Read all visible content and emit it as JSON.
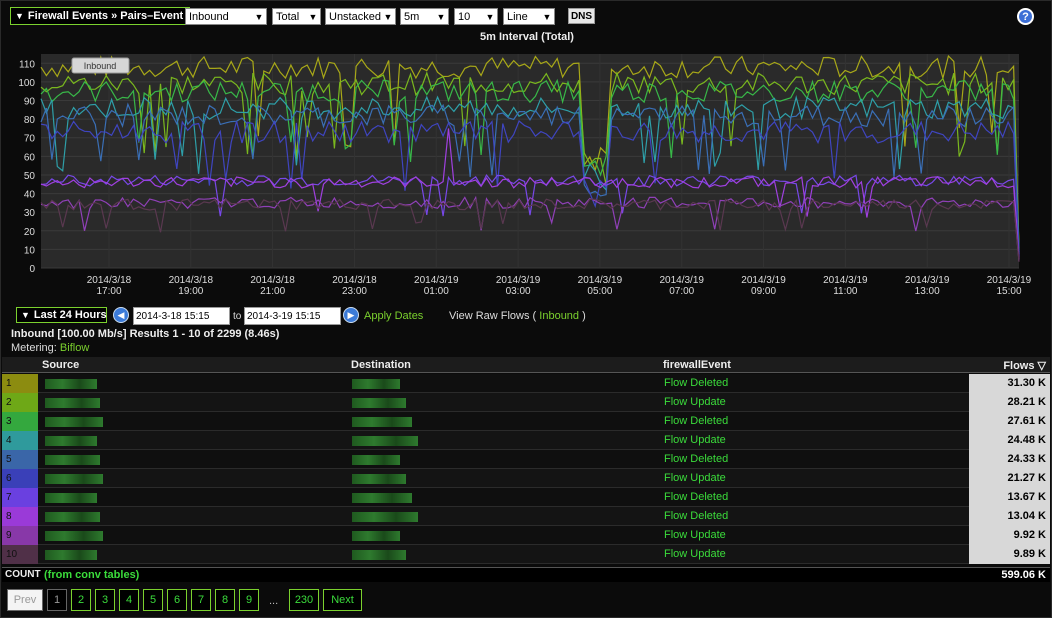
{
  "header": {
    "breadcrumb": "Firewall Events » Pairs–Event",
    "selects": [
      {
        "name": "direction-select",
        "value": "Inbound"
      },
      {
        "name": "total-select",
        "value": "Total"
      },
      {
        "name": "stacking-select",
        "value": "Unstacked"
      },
      {
        "name": "interval-select",
        "value": "5m"
      },
      {
        "name": "count-select",
        "value": "10"
      },
      {
        "name": "charttype-select",
        "value": "Line"
      }
    ],
    "dns_label": "DNS",
    "help_label": "?"
  },
  "chart_data": {
    "type": "line",
    "title": "5m Interval (Total)",
    "tooltip_label": "Inbound",
    "ylim": [
      0,
      115
    ],
    "yticks": [
      0,
      10,
      20,
      30,
      40,
      50,
      60,
      70,
      80,
      90,
      100,
      110
    ],
    "xticks": [
      {
        "date": "2014/3/18",
        "time": "17:00"
      },
      {
        "date": "2014/3/18",
        "time": "19:00"
      },
      {
        "date": "2014/3/18",
        "time": "21:00"
      },
      {
        "date": "2014/3/18",
        "time": "23:00"
      },
      {
        "date": "2014/3/19",
        "time": "01:00"
      },
      {
        "date": "2014/3/19",
        "time": "03:00"
      },
      {
        "date": "2014/3/19",
        "time": "05:00"
      },
      {
        "date": "2014/3/19",
        "time": "07:00"
      },
      {
        "date": "2014/3/19",
        "time": "09:00"
      },
      {
        "date": "2014/3/19",
        "time": "11:00"
      },
      {
        "date": "2014/3/19",
        "time": "13:00"
      },
      {
        "date": "2014/3/19",
        "time": "15:00"
      }
    ],
    "grid": true,
    "series": [
      {
        "rank": "1",
        "color": "#a8a818",
        "level": 108
      },
      {
        "rank": "2",
        "color": "#7ab81e",
        "level": 99
      },
      {
        "rank": "3",
        "color": "#38b848",
        "level": 95
      },
      {
        "rank": "4",
        "color": "#2e9fa8",
        "level": 86
      },
      {
        "rank": "5",
        "color": "#3a6fb6",
        "level": 82
      },
      {
        "rank": "6",
        "color": "#3f45c0",
        "level": 73
      },
      {
        "rank": "7",
        "color": "#7848e8",
        "level": 47
      },
      {
        "rank": "8",
        "color": "#a040e0",
        "level": 46
      },
      {
        "rank": "9",
        "color": "#9040b8",
        "level": 35
      },
      {
        "rank": "10",
        "color": "#5a3850",
        "level": 34
      }
    ]
  },
  "daterange": {
    "range_label": "Last 24 Hours",
    "start": "2014-3-18 15:15",
    "to_label": "to",
    "end": "2014-3-19 15:15",
    "apply_label": "Apply Dates",
    "raw_prefix": "View Raw Flows (",
    "raw_link": "Inbound",
    "raw_suffix": ")"
  },
  "summary": {
    "text": "Inbound [100.00 Mb/s] Results 1 - 10 of 2299 (8.46s)",
    "metering_label": "Metering:",
    "metering_value": "Biflow"
  },
  "table": {
    "columns": {
      "source": "Source",
      "destination": "Destination",
      "event": "firewallEvent",
      "flows": "Flows ▽"
    },
    "rows": [
      {
        "rank": "1",
        "color": "#8c8c10",
        "event": "Flow Deleted",
        "flows": "31.30 K"
      },
      {
        "rank": "2",
        "color": "#6ea817",
        "event": "Flow Update",
        "flows": "28.21 K"
      },
      {
        "rank": "3",
        "color": "#34a83e",
        "event": "Flow Deleted",
        "flows": "27.61 K"
      },
      {
        "rank": "4",
        "color": "#2f9a9c",
        "event": "Flow Update",
        "flows": "24.48 K"
      },
      {
        "rank": "5",
        "color": "#3a66a8",
        "event": "Flow Deleted",
        "flows": "24.33 K"
      },
      {
        "rank": "6",
        "color": "#3a40b8",
        "event": "Flow Update",
        "flows": "21.27 K"
      },
      {
        "rank": "7",
        "color": "#6a40e0",
        "event": "Flow Deleted",
        "flows": "13.67 K"
      },
      {
        "rank": "8",
        "color": "#9a3ad8",
        "event": "Flow Deleted",
        "flows": "13.04 K"
      },
      {
        "rank": "9",
        "color": "#8838a8",
        "event": "Flow Update",
        "flows": "9.92 K"
      },
      {
        "rank": "10",
        "color": "#503048",
        "event": "Flow Update",
        "flows": "9.89 K"
      }
    ],
    "count_label": "COUNT",
    "count_note": "(from conv tables)",
    "count_total": "599.06 K"
  },
  "pager": {
    "prev": "Prev",
    "pages": [
      "1",
      "2",
      "3",
      "4",
      "5",
      "6",
      "7",
      "8",
      "9"
    ],
    "ellipsis": "...",
    "last": "230",
    "next": "Next"
  }
}
